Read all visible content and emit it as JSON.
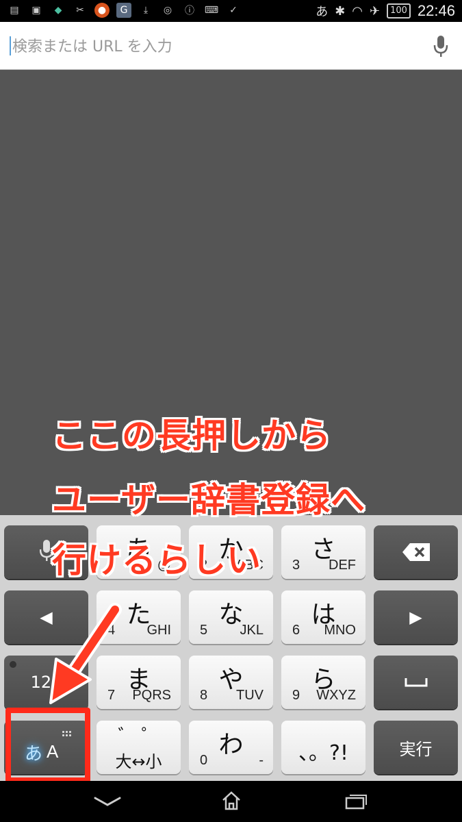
{
  "status_bar": {
    "ime_indicator": "あ",
    "battery": "100",
    "time": "22:46",
    "left_icons": [
      "clipboard-icon",
      "news-icon",
      "app-icon",
      "scissors-icon",
      "orange-app-icon",
      "google-icon",
      "download-icon",
      "chat-icon",
      "info-icon",
      "keyboard-icon",
      "check-icon"
    ],
    "right_icons": [
      "bluetooth-icon",
      "wifi-icon",
      "airplane-icon"
    ]
  },
  "search": {
    "placeholder": "検索または URL を入力",
    "value": ""
  },
  "annotation": {
    "line1": "ここの長押しから",
    "line2": "ユーザー辞書登録へ",
    "line3": "行けるらしい",
    "color": "#ff3a22"
  },
  "keyboard": {
    "row1": [
      {
        "kana": "あ",
        "num": "1",
        "latin": "@"
      },
      {
        "kana": "か",
        "num": "2",
        "latin": "ABC"
      },
      {
        "kana": "さ",
        "num": "3",
        "latin": "DEF"
      }
    ],
    "row2": [
      {
        "kana": "た",
        "num": "4",
        "latin": "GHI"
      },
      {
        "kana": "な",
        "num": "5",
        "latin": "JKL"
      },
      {
        "kana": "は",
        "num": "6",
        "latin": "MNO"
      }
    ],
    "row3": [
      {
        "kana": "ま",
        "num": "7",
        "latin": "PQRS"
      },
      {
        "kana": "や",
        "num": "8",
        "latin": "TUV"
      },
      {
        "kana": "ら",
        "num": "9",
        "latin": "WXYZ"
      }
    ],
    "row4": {
      "dakuten_top": "゛ ゜",
      "dakuten_bottom": "大↔小",
      "wa_kana": "わ",
      "wa_num": "0",
      "wa_latin": "-",
      "punct": "、。?!"
    },
    "mode_key": {
      "kana": "あ",
      "latin": "A"
    },
    "num_key": "123",
    "enter_key": "実行"
  },
  "nav_icons": [
    "back-icon",
    "home-icon",
    "recents-icon"
  ]
}
